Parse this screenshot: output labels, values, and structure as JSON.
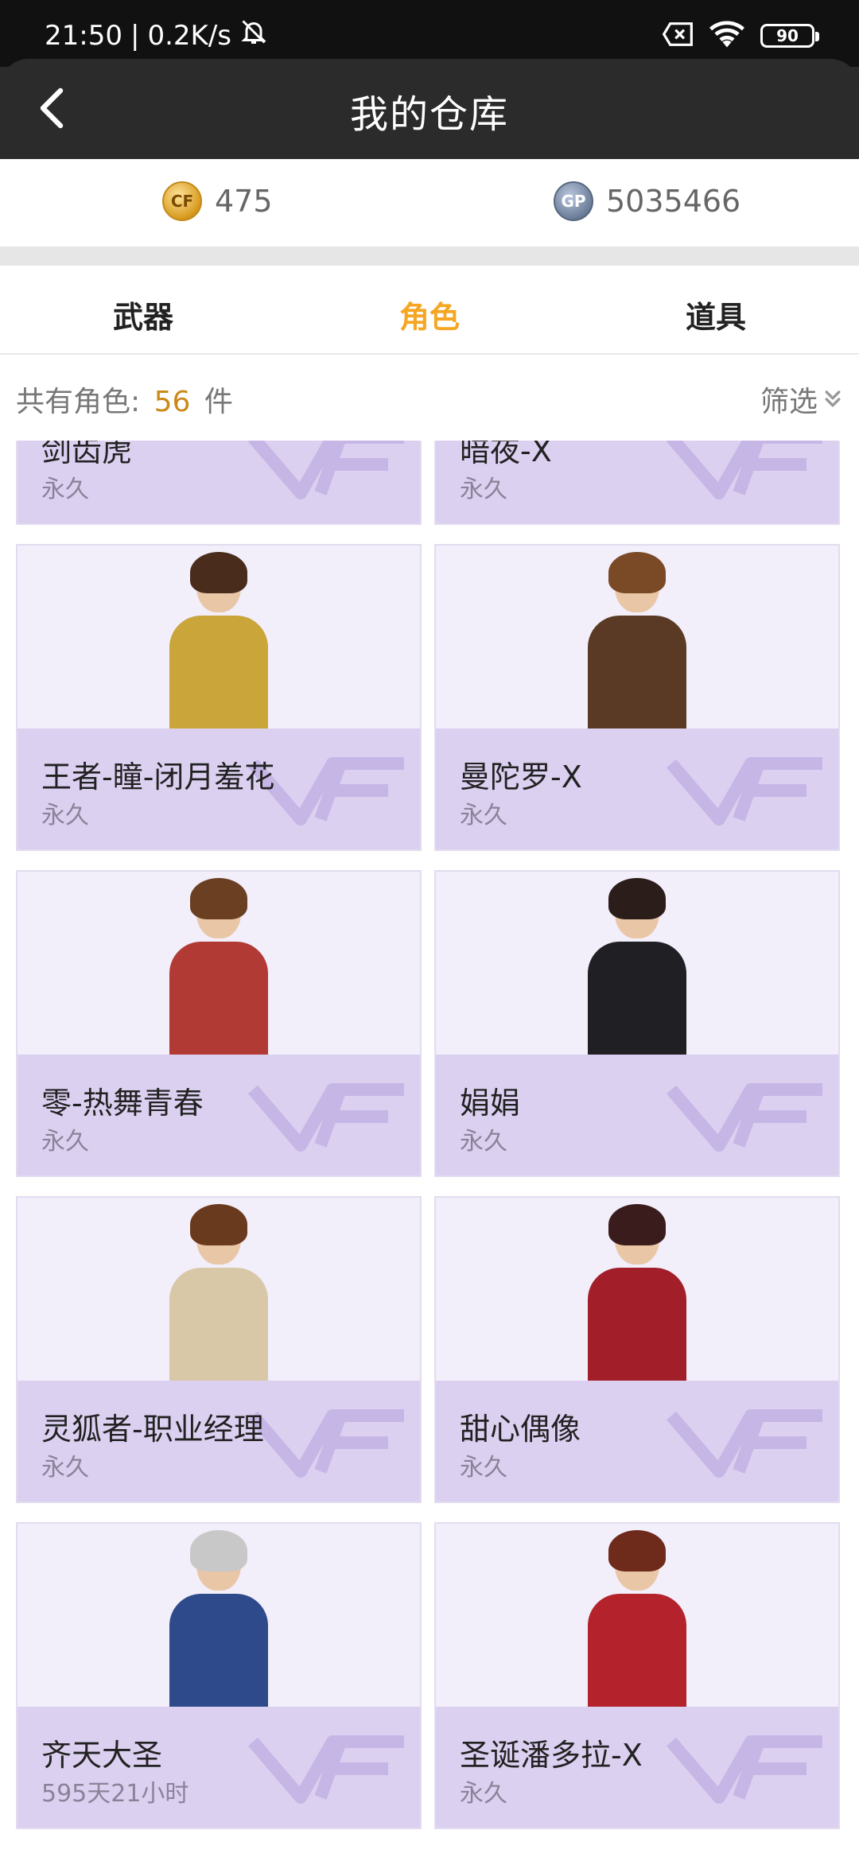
{
  "status": {
    "time": "21:50",
    "net_speed": "0.2K/s",
    "battery": "90"
  },
  "header": {
    "title": "我的仓库"
  },
  "currency": {
    "coin_value": "475",
    "gp_label": "GP",
    "gp_value": "5035466"
  },
  "tabs": [
    {
      "label": "武器",
      "active": false
    },
    {
      "label": "角色",
      "active": true
    },
    {
      "label": "道具",
      "active": false
    }
  ],
  "summary": {
    "prefix": "共有角色:",
    "count": "56",
    "suffix": "件",
    "filter_label": "筛选"
  },
  "items": [
    {
      "name": "剑齿虎",
      "duration": "永久"
    },
    {
      "name": "暗夜-X",
      "duration": "永久"
    },
    {
      "name": "王者-瞳-闭月羞花",
      "duration": "永久"
    },
    {
      "name": "曼陀罗-X",
      "duration": "永久"
    },
    {
      "name": "零-热舞青春",
      "duration": "永久"
    },
    {
      "name": "娟娟",
      "duration": "永久"
    },
    {
      "name": "灵狐者-职业经理",
      "duration": "永久"
    },
    {
      "name": "甜心偶像",
      "duration": "永久"
    },
    {
      "name": "齐天大圣",
      "duration": "595天21小时"
    },
    {
      "name": "圣诞潘多拉-X",
      "duration": "永久"
    }
  ],
  "colors": {
    "accent": "#f5a623",
    "card_bg": "#f2eefa",
    "card_info": "#dcd0f1",
    "header_bg": "#2b2b2b"
  }
}
